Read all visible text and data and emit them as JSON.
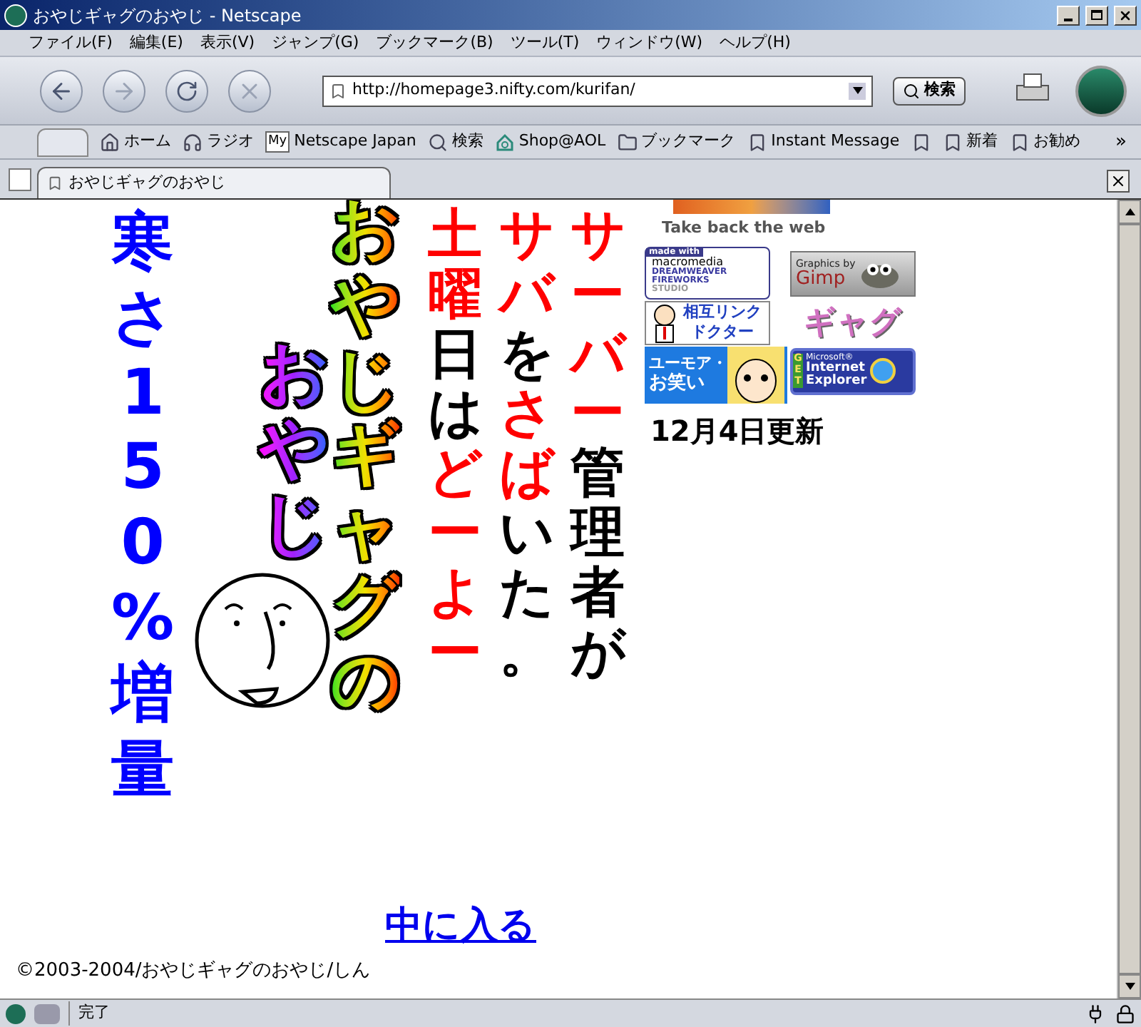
{
  "window": {
    "title": "おやじギャグのおやじ - Netscape"
  },
  "menu": [
    "ファイル(F)",
    "編集(E)",
    "表示(V)",
    "ジャンプ(G)",
    "ブックマーク(B)",
    "ツール(T)",
    "ウィンドウ(W)",
    "ヘルプ(H)"
  ],
  "address": {
    "value": "http://homepage3.nifty.com/kurifan/"
  },
  "search_button": "検索",
  "personal_toolbar": [
    {
      "kind": "labeled",
      "label": "ホーム"
    },
    {
      "kind": "labeled",
      "label": "ラジオ"
    },
    {
      "kind": "labeled",
      "label": "Netscape Japan",
      "badge": "My"
    },
    {
      "kind": "labeled",
      "label": "検索"
    },
    {
      "kind": "labeled",
      "label": "Shop@AOL"
    },
    {
      "kind": "labeled",
      "label": "ブックマーク"
    },
    {
      "kind": "labeled",
      "label": "Instant Message"
    },
    {
      "kind": "icon_only"
    },
    {
      "kind": "labeled",
      "label": "新着"
    },
    {
      "kind": "labeled",
      "label": "お勧め"
    }
  ],
  "overflow": "»",
  "tab": {
    "label": "おやじギャグのおやじ",
    "selected": true
  },
  "page": {
    "slogan": "寒さ150%増量",
    "title_columns": [
      "おやじ",
      "おやじギャグの"
    ],
    "headline_columns": [
      {
        "segments": [
          {
            "text": "土曜",
            "color": "#ff0000"
          },
          {
            "text": "日は",
            "color": "#000000"
          },
          {
            "text": "どーよー",
            "color": "#ff0000"
          }
        ]
      },
      {
        "segments": [
          {
            "text": "サバ",
            "color": "#ff0000"
          },
          {
            "text": "を",
            "color": "#000000"
          },
          {
            "text": "さば",
            "color": "#ff0000"
          },
          {
            "text": "いた。",
            "color": "#000000"
          }
        ]
      },
      {
        "segments": [
          {
            "text": "サーバー",
            "color": "#ff0000"
          },
          {
            "text": "管理者が",
            "color": "#000000"
          }
        ]
      }
    ],
    "caption": "Take back the web",
    "banners": [
      {
        "kind": "macromedia",
        "lines": [
          "made with",
          "macromedia",
          "DREAMWEAVER",
          "FIREWORKS",
          "STUDIO"
        ]
      },
      {
        "kind": "gimp",
        "lines": [
          "Graphics by",
          "Gimp"
        ]
      },
      {
        "kind": "doctor",
        "lines": [
          "相互リンク",
          "ドクター"
        ]
      },
      {
        "kind": "gag",
        "lines": [
          "ギャグ"
        ]
      },
      {
        "kind": "humor",
        "lines": [
          "ユーモア・",
          "お笑い"
        ]
      },
      {
        "kind": "ie",
        "lines": [
          "GET",
          "Microsoft®",
          "Internet",
          "Explorer"
        ]
      }
    ],
    "update": "12月4日更新",
    "enter_link": "中に入る",
    "footer": "©2003-2004/おやじギャグのおやじ/しん"
  },
  "status_bar": {
    "text": "完了"
  }
}
